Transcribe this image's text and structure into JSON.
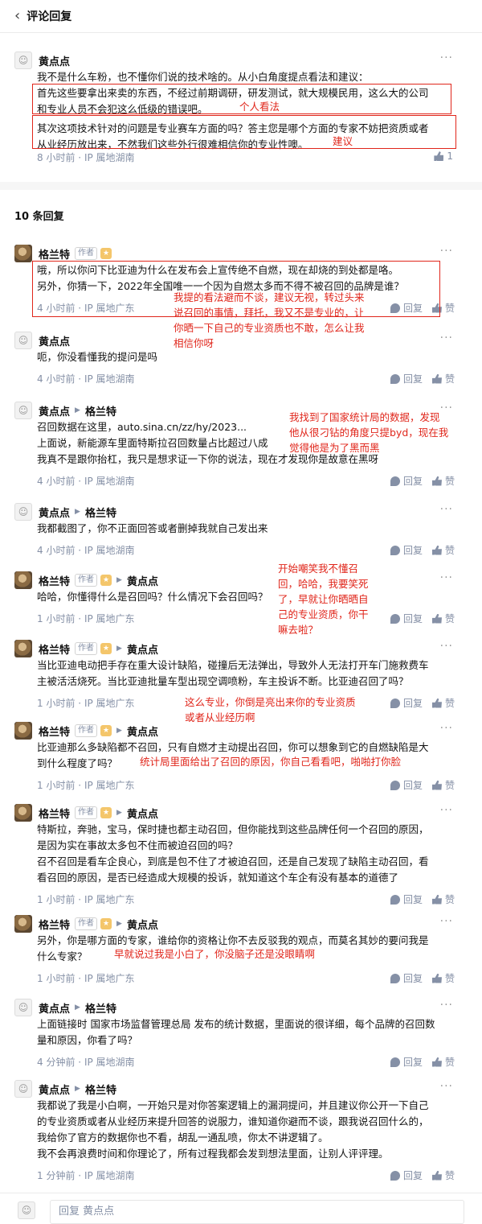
{
  "header": {
    "back_icon": "chevron-left-icon",
    "title": "评论回复"
  },
  "root": {
    "author": "黄点点",
    "lines": [
      "我不是什么车粉，也不懂你们说的技术啥的。从小白角度提点看法和建议：",
      "首先这些要拿出来卖的东西，不经过前期调研，研发测试，就大规模民用，这么大的公司",
      "和专业人员不会犯这么低级的错误吧。",
      "其次这项技术针对的问题是专业赛车方面的吗？答主您是哪个方面的专家不妨把资质或者",
      "从业经历放出来，不然我们这些外行很难相信你的专业性噢。"
    ],
    "time": "8 小时前",
    "ip": "IP 属地湖南",
    "likes": "1"
  },
  "replies_header": "10 条回复",
  "common": {
    "author_tag": "作者",
    "reply": "回复",
    "like": "赞",
    "more": "···",
    "sep": "·"
  },
  "replies": [
    {
      "author": "格兰特",
      "is_author": true,
      "to": "",
      "lines": [
        "哦，所以你问下比亚迪为什么在发布会上宣传绝不自燃，现在却烧的到处都是咯。",
        "另外，你猜一下，2022年全国唯一一个因为自燃太多而不得不被召回的品牌是谁？"
      ],
      "time": "4 小时前",
      "ip": "IP 属地广东"
    },
    {
      "author": "黄点点",
      "is_author": false,
      "to": "",
      "lines": [
        "呃，你没看懂我的提问是吗"
      ],
      "time": "4 小时前",
      "ip": "IP 属地湖南"
    },
    {
      "author": "黄点点",
      "is_author": false,
      "to": "格兰特",
      "lines": [
        "召回数据在这里，auto.sina.cn/zz/hy/2023...",
        "上面说，新能源车里面特斯拉召回数量占比超过八成",
        "我真不是跟你抬杠，我只是想求证一下你的说法，现在才发现你是故意在黑呀"
      ],
      "time": "4 小时前",
      "ip": "IP 属地湖南"
    },
    {
      "author": "黄点点",
      "is_author": false,
      "to": "格兰特",
      "lines": [
        "我都截图了，你不正面回答或者删掉我就自己发出来"
      ],
      "time": "4 小时前",
      "ip": "IP 属地湖南"
    },
    {
      "author": "格兰特",
      "is_author": true,
      "to": "黄点点",
      "lines": [
        "哈哈，你懂得什么是召回吗？什么情况下会召回吗？"
      ],
      "time": "1 小时前",
      "ip": "IP 属地广东"
    },
    {
      "author": "格兰特",
      "is_author": true,
      "to": "黄点点",
      "lines": [
        "当比亚迪电动把手存在重大设计缺陷，碰撞后无法弹出，导致外人无法打开车门施救费车",
        "主被活活烧死。当比亚迪批量车型出现空调喷粉，车主投诉不断。比亚迪召回了吗？"
      ],
      "time": "1 小时前",
      "ip": "IP 属地广东"
    },
    {
      "author": "格兰特",
      "is_author": true,
      "to": "黄点点",
      "lines": [
        "比亚迪那么多缺陷都不召回，只有自燃才主动提出召回，你可以想象到它的自燃缺陷是大",
        "到什么程度了吗？"
      ],
      "time": "1 小时前",
      "ip": "IP 属地广东"
    },
    {
      "author": "格兰特",
      "is_author": true,
      "to": "黄点点",
      "lines": [
        "特斯拉，奔驰，宝马，保时捷也都主动召回，但你能找到这些品牌任何一个召回的原因，",
        "是因为实在事故太多包不住而被迫召回的吗？",
        "召不召回是看车企良心，到底是包不住了才被迫召回，还是自己发现了缺陷主动召回，看",
        "看召回的原因，是否已经造成大规模的投诉，就知道这个车企有没有基本的道德了"
      ],
      "time": "1 小时前",
      "ip": "IP 属地广东"
    },
    {
      "author": "格兰特",
      "is_author": true,
      "to": "黄点点",
      "lines": [
        "另外，你是哪方面的专家，谁给你的资格让你不去反驳我的观点，而莫名其妙的要问我是",
        "什么专家？"
      ],
      "time": "1 小时前",
      "ip": "IP 属地广东"
    },
    {
      "author": "黄点点",
      "is_author": false,
      "to": "格兰特",
      "lines": [
        "上面链接时 国家市场监督管理总局 发布的统计数据，里面说的很详细，每个品牌的召回数",
        "量和原因，你看了吗？"
      ],
      "time": "4 分钟前",
      "ip": "IP 属地湖南"
    },
    {
      "author": "黄点点",
      "is_author": false,
      "to": "格兰特",
      "lines": [
        "我都说了我是小白啊，一开始只是对你答案逻辑上的漏洞提问，并且建议你公开一下自己",
        "的专业资质或者从业经历来提升回答的说服力，谁知道你避而不谈，跟我说召回什么的，",
        "我给你了官方的数据你也不看，胡乱一通乱喷，你太不讲逻辑了。",
        "我不会再浪费时间和你理论了，所有过程我都会发到想法里面，让别人评评理。"
      ],
      "time": "1 分钟前",
      "ip": "IP 属地湖南"
    }
  ],
  "annotations": {
    "a1": "个人看法",
    "a2": "建议",
    "a3": [
      "我提的看法避而不谈，建议无视，转过头来",
      "说召回的事情，拜托，我又不是专业的，让",
      "你晒一下自己的专业资质也不敢，怎么让我",
      "相信你呀"
    ],
    "a4": [
      "我找到了国家统计局的数据，发现",
      "他从很刁钻的角度只提byd，现在我",
      "觉得他是为了黑而黑"
    ],
    "a5": [
      "开始嘲笑我不懂召",
      "回，哈哈，我要笑死",
      "了，早就让你晒晒自",
      "己的专业资质，你干",
      "嘛去啦？"
    ],
    "a6": [
      "这么专业，你倒是亮出来你的专业资质",
      "或者从业经历啊"
    ],
    "a7": "统计局里面给出了召回的原因，你自己看看吧，啪啪打你脸",
    "a8": "早就说过我是小白了，你没脑子还是没眼睛啊"
  },
  "composer": {
    "placeholder": "回复 黄点点"
  }
}
